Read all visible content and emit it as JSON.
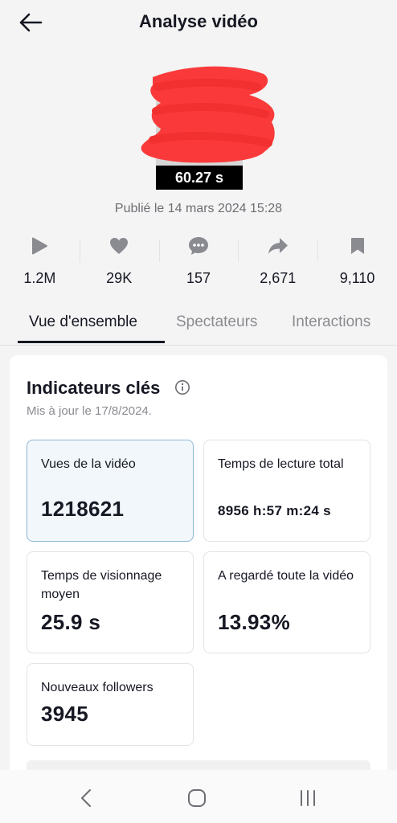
{
  "header": {
    "title": "Analyse vidéo",
    "back_icon": "arrow-left-icon"
  },
  "video": {
    "duration": "60.27 s",
    "published": "Publié le 14 mars 2024 15:28"
  },
  "stats": [
    {
      "icon": "play-icon",
      "value": "1.2M"
    },
    {
      "icon": "heart-icon",
      "value": "29K"
    },
    {
      "icon": "comment-icon",
      "value": "157"
    },
    {
      "icon": "share-icon",
      "value": "2,671"
    },
    {
      "icon": "bookmark-icon",
      "value": "9,110"
    }
  ],
  "tabs": [
    {
      "label": "Vue d'ensemble",
      "active": true
    },
    {
      "label": "Spectateurs",
      "active": false
    },
    {
      "label": "Interactions",
      "active": false
    }
  ],
  "key_metrics": {
    "title": "Indicateurs clés",
    "updated": "Mis à jour le 17/8/2024.",
    "items": [
      {
        "label": "Vues de la vidéo",
        "value": "1218621"
      },
      {
        "label": "Temps de lecture total",
        "value": "8956 h:57 m:24 s"
      },
      {
        "label": "Temps de visionnage moyen",
        "value": "25.9 s"
      },
      {
        "label": "A regardé toute la vidéo",
        "value": "13.93%"
      },
      {
        "label": "Nouveaux followers",
        "value": "3945"
      }
    ]
  },
  "colors": {
    "censor": "#fa3a3a",
    "selected_card_bg": "#f2f7fb",
    "selected_card_border": "#8cb8d5",
    "icon_gray": "#8a8b91"
  },
  "navbar": {
    "back_icon": "nav-back-icon",
    "home_icon": "nav-home-icon",
    "recents_icon": "nav-recents-icon"
  }
}
